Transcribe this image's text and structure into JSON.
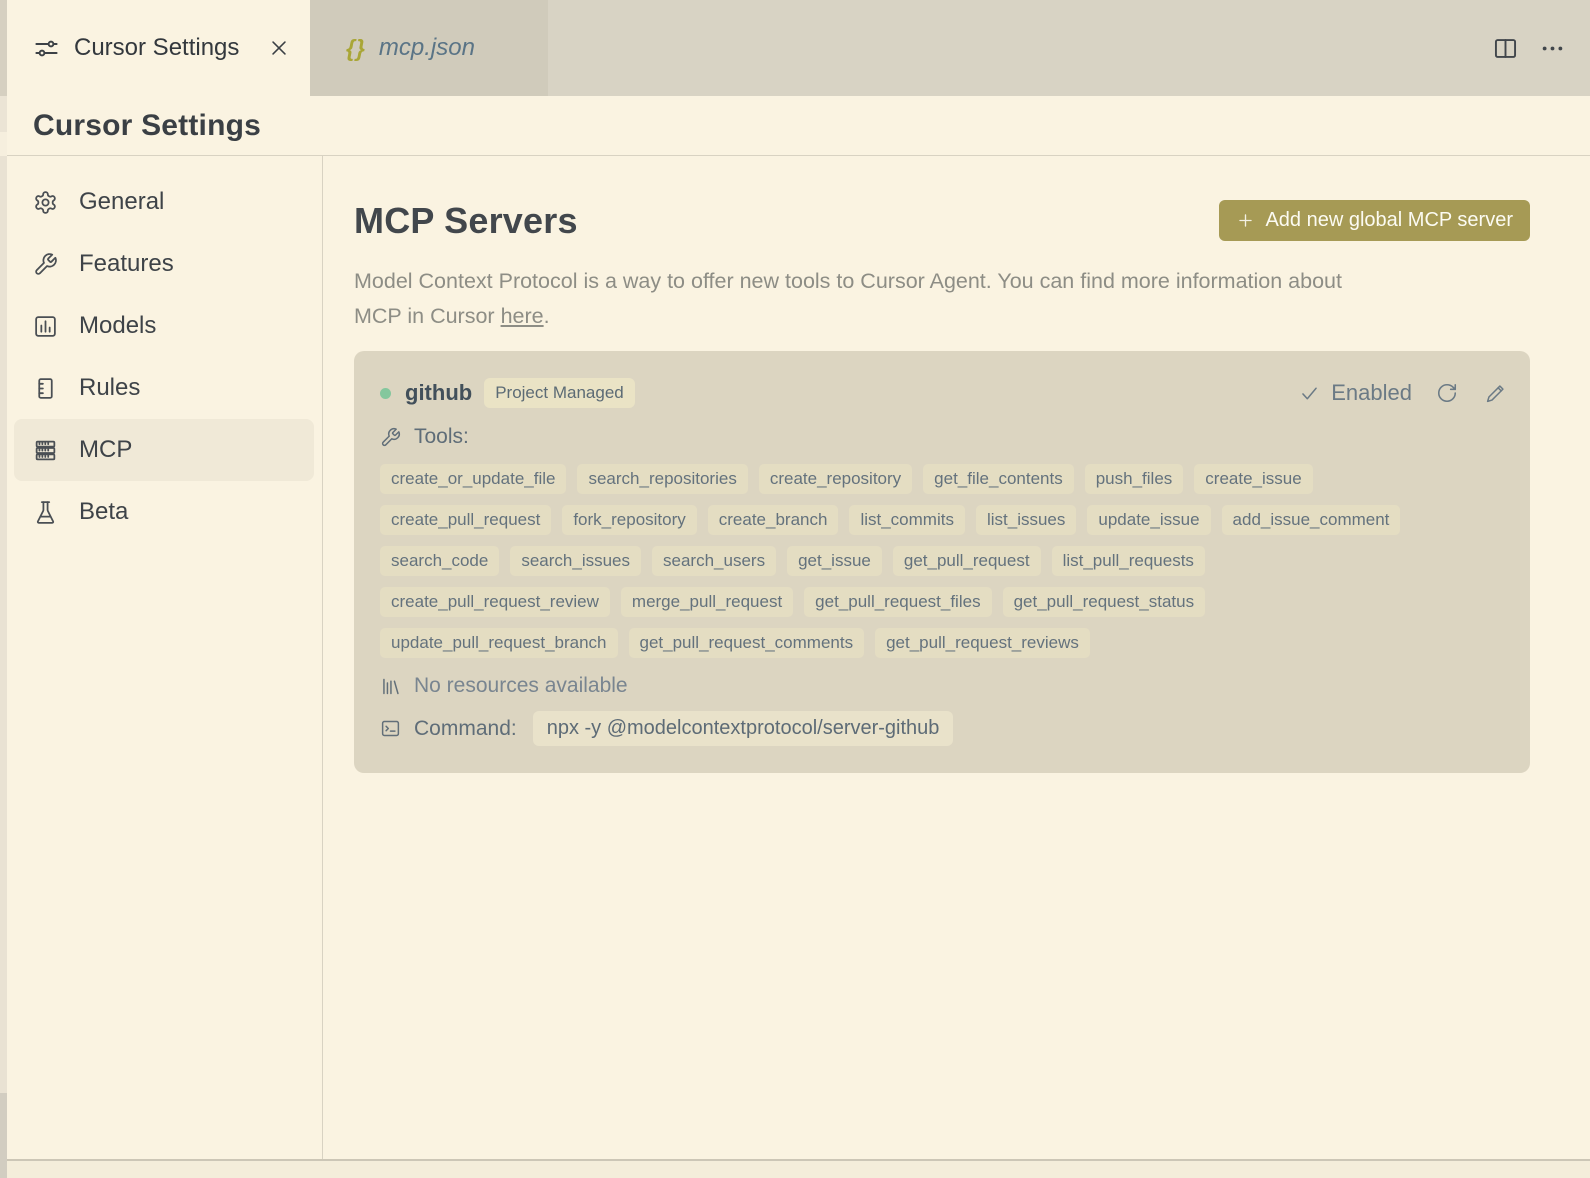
{
  "window": {
    "tab_bar": {
      "tabs": [
        {
          "label": "Cursor Settings",
          "icon": "sliders-icon",
          "active": true,
          "close_icon": "close-icon"
        },
        {
          "label": "mcp.json",
          "icon": "braces-icon",
          "active": false
        }
      ],
      "braces_glyph": "{}",
      "actions": [
        {
          "icon": "split-editor-icon"
        },
        {
          "icon": "more-actions-icon"
        }
      ]
    },
    "page_header": {
      "title": "Cursor Settings"
    }
  },
  "sidebar": {
    "items": [
      {
        "label": "General",
        "icon": "gear-icon"
      },
      {
        "label": "Features",
        "icon": "tools-icon"
      },
      {
        "label": "Models",
        "icon": "bar-chart-icon"
      },
      {
        "label": "Rules",
        "icon": "rules-icon"
      },
      {
        "label": "MCP",
        "icon": "server-stack-icon",
        "active": true
      },
      {
        "label": "Beta",
        "icon": "flask-icon"
      }
    ]
  },
  "main": {
    "title": "MCP Servers",
    "description": {
      "line1": "Model Context Protocol is a way to offer new tools to Cursor Agent. You can find more information about",
      "line2_before_link": "MCP in Cursor ",
      "link_text": "here",
      "after_link": "."
    },
    "add_button": {
      "icon": "plus-icon",
      "label": "Add new global MCP server"
    }
  },
  "server_card": {
    "name": "github",
    "badge": "Project Managed",
    "status_label": "Enabled",
    "status_icons": [
      "check-icon",
      "refresh-icon",
      "pencil-icon"
    ],
    "tools_label": "Tools:",
    "tools_icon": "tools-icon",
    "tool_rows": [
      [
        "create_or_update_file",
        "search_repositories",
        "create_repository",
        "get_file_contents",
        "push_files",
        "create_issue"
      ],
      [
        "create_pull_request",
        "fork_repository",
        "create_branch",
        "list_commits",
        "list_issues",
        "update_issue",
        "add_issue_comment"
      ],
      [
        "search_code",
        "search_issues",
        "search_users",
        "get_issue",
        "get_pull_request",
        "list_pull_requests"
      ],
      [
        "create_pull_request_review",
        "merge_pull_request",
        "get_pull_request_files",
        "get_pull_request_status"
      ],
      [
        "update_pull_request_branch",
        "get_pull_request_comments",
        "get_pull_request_reviews"
      ]
    ],
    "resources_text": "No resources available",
    "resources_icon": "library-icon",
    "command_label": "Command:",
    "command_icon": "terminal-icon",
    "command_value": "npx -y @modelcontextprotocol/server-github"
  },
  "colors": {
    "background": "#faf3e1",
    "tab_strip": "#d8d3c4",
    "inactive_tab": "#d0cbbb",
    "card": "#dcd5c1",
    "chip": "#e4ddc2",
    "badge": "#eae3c5",
    "command_chip": "#e9e2ca",
    "accent_button": "#a69a55",
    "status_green": "#84c79d",
    "sidebar_highlight": "#f0e9d7"
  }
}
